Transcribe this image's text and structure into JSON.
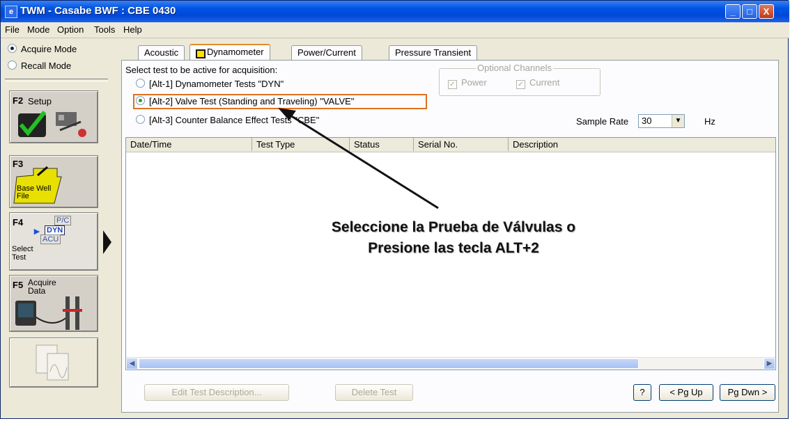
{
  "window": {
    "title": "TWM  -  Casabe BWF : CBE 0430",
    "app_icon": "twm-app-icon",
    "controls": [
      "_",
      "□",
      "X"
    ]
  },
  "menu": [
    "File",
    "Mode",
    "Option",
    "Tools",
    "Help"
  ],
  "left_panel": {
    "modes": [
      {
        "label": "Acquire Mode",
        "selected": true
      },
      {
        "label": "Recall Mode",
        "selected": false
      }
    ],
    "functions": [
      {
        "key": "F2",
        "label": "Setup"
      },
      {
        "key": "F3",
        "label": "Base Well File"
      },
      {
        "key": "F4",
        "label": "Select Test",
        "badges": [
          "P/C",
          "DYN",
          "ACU"
        ]
      },
      {
        "key": "F5",
        "label": "Acquire Data"
      }
    ]
  },
  "tabs": [
    "Acoustic",
    "Dynamometer",
    "Power/Current",
    "Pressure Transient"
  ],
  "active_tab": "Dynamometer",
  "test_select": {
    "prompt": "Select test to be active for acquisition:",
    "options": [
      {
        "label": "[Alt-1] Dynamometer Tests  \"DYN\"",
        "selected": false
      },
      {
        "label": "[Alt-2] Valve Test (Standing and Traveling)  \"VALVE\"",
        "selected": true
      },
      {
        "label": "[Alt-3] Counter Balance Effect Tests  \"CBE\"",
        "selected": false
      }
    ]
  },
  "optional_channels": {
    "title": "Optional Channels",
    "power": "Power",
    "current": "Current"
  },
  "sample_rate": {
    "label": "Sample Rate",
    "value": "30",
    "unit": "Hz"
  },
  "table": {
    "columns": [
      "Date/Time",
      "Test Type",
      "Status",
      "Serial No.",
      "Description"
    ],
    "rows": []
  },
  "buttons": {
    "edit": "Edit Test Description...",
    "delete": "Delete Test",
    "help": "?",
    "pgup": "< Pg Up",
    "pgdn": "Pg Dwn >"
  },
  "annotation": {
    "line1": "Seleccione la Prueba de Válvulas o",
    "line2": "Presione las tecla ALT+2"
  },
  "colors": {
    "title_bar": "#0054e3",
    "highlight_box": "#e07020",
    "radio_selected": "#21a121"
  }
}
